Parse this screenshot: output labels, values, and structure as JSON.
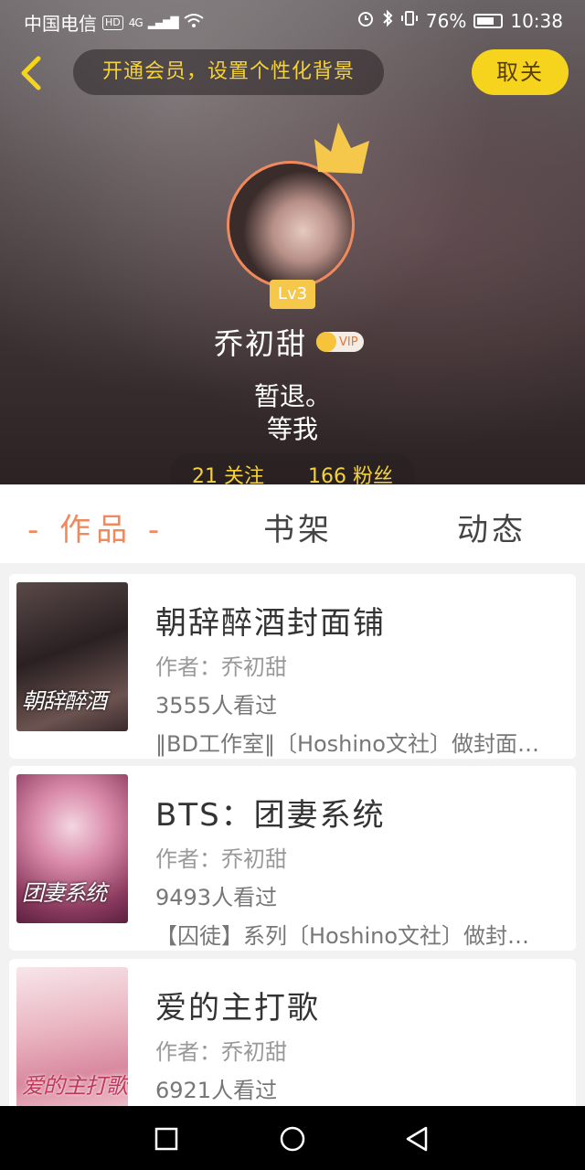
{
  "status_bar": {
    "carrier": "中国电信",
    "hd": "HD",
    "network": "4G",
    "battery": "76%",
    "battery_level": 0.76,
    "time": "10:38"
  },
  "header": {
    "vip_banner": "开通会员，设置个性化背景",
    "close_label": "取关",
    "level": "Lv3",
    "username": "乔初甜",
    "vip_badge": "VIP",
    "bio_line1": "暂退。",
    "bio_line2": "等我",
    "following": "21 关注",
    "followers": "166 粉丝"
  },
  "tabs": [
    {
      "label": "- 作品 -",
      "active": true
    },
    {
      "label": "书架",
      "active": false
    },
    {
      "label": "动态",
      "active": false
    }
  ],
  "works": [
    {
      "cover_text": "朝辞醉酒",
      "title": "朝辞醉酒封面铺",
      "author": "作者：乔初甜",
      "views": "3555人看过",
      "tags": "‖BD工作室‖〔Hoshino文社〕做封面的…"
    },
    {
      "cover_text": "团妻系统",
      "title": "BTS：团妻系统",
      "author": "作者：乔初甜",
      "views": "9493人看过",
      "tags": "【囚徒】系列〔Hoshino文社〕做封面的…"
    },
    {
      "cover_text": "爱的主打歌",
      "title": "爱的主打歌",
      "author": "作者：乔初甜",
      "views": "6921人看过",
      "tags": ""
    }
  ],
  "colors": {
    "accent": "#f08a5d",
    "vip_yellow": "#f6d41e",
    "nav_bg": "#000000"
  }
}
